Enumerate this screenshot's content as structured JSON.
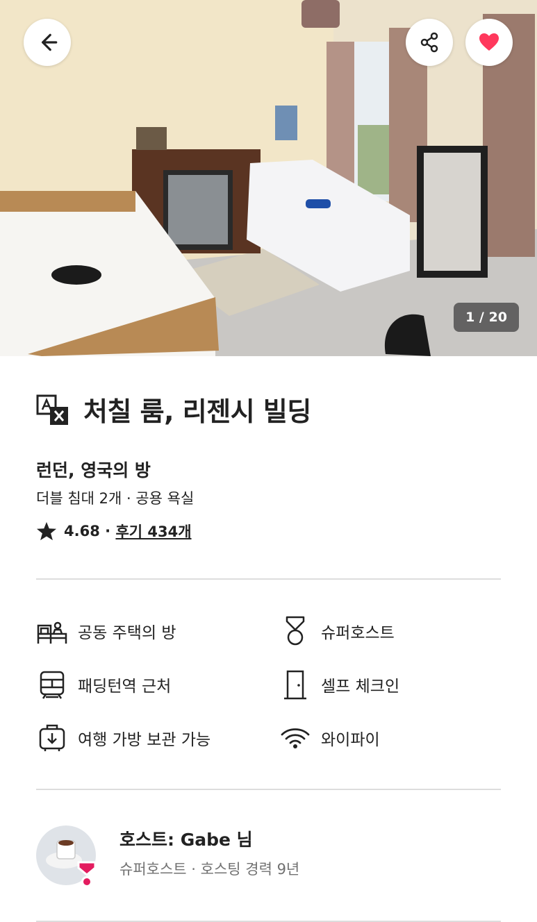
{
  "gallery": {
    "counter": "1 / 20"
  },
  "listing": {
    "title": "처칠 룸, 리젠시 빌딩",
    "subtitle": "런던, 영국의 방",
    "details": "더블 침대 2개 · 공용 욕실",
    "rating": "4.68",
    "rating_separator": " · ",
    "reviews": "후기 434개"
  },
  "amenities": [
    {
      "label": "공동 주택의 방",
      "icon": "house-icon"
    },
    {
      "label": "슈퍼호스트",
      "icon": "medal-icon"
    },
    {
      "label": "패딩턴역 근처",
      "icon": "train-icon"
    },
    {
      "label": "셀프 체크인",
      "icon": "door-icon"
    },
    {
      "label": "여행 가방 보관 가능",
      "icon": "luggage-icon"
    },
    {
      "label": "와이파이",
      "icon": "wifi-icon"
    }
  ],
  "host": {
    "name": "호스트: Gabe 님",
    "meta": "슈퍼호스트 · 호스팅 경력 9년"
  },
  "colors": {
    "accent": "#E31C5F",
    "heart": "#FF385C",
    "text": "#222222",
    "muted": "#717171"
  }
}
